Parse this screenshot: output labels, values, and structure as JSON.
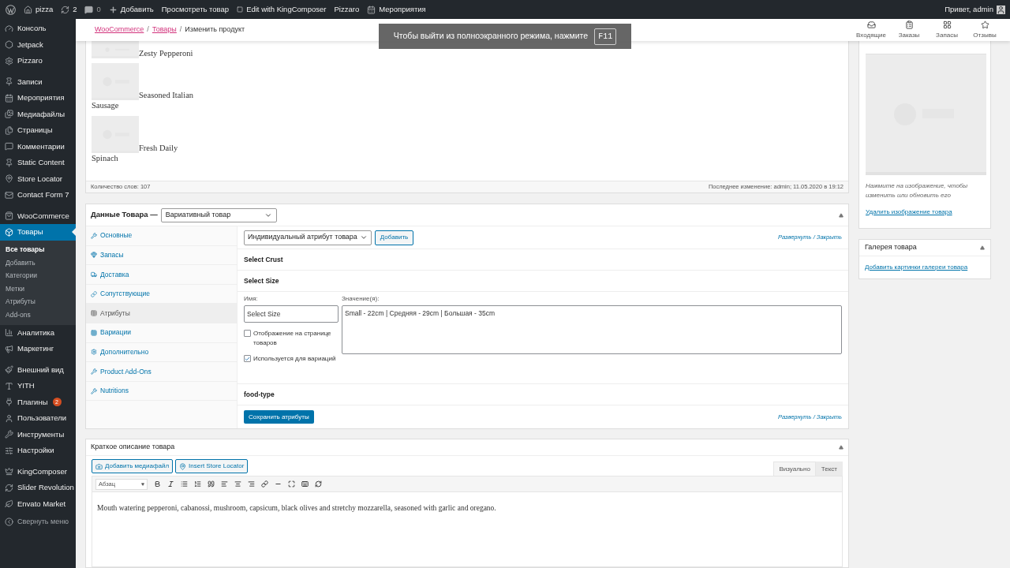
{
  "admin_bar": {
    "items": [
      {
        "kind": "logo"
      },
      {
        "kind": "home",
        "label": "pizza"
      },
      {
        "kind": "updates",
        "label": "2"
      },
      {
        "kind": "comments",
        "label": "0"
      },
      {
        "kind": "new",
        "label": "Добавить"
      },
      {
        "kind": "text",
        "label": "Просмотреть товар"
      },
      {
        "kind": "kc",
        "label": "Edit with KingComposer"
      },
      {
        "kind": "text",
        "label": "Pizzaro"
      },
      {
        "kind": "calendar",
        "label": "Мероприятия"
      }
    ],
    "greeting": "Привет, admin"
  },
  "sidebar": {
    "groups": [
      {
        "items": [
          {
            "label": "Консоль",
            "selected": false
          },
          {
            "label": "Jetpack",
            "selected": false
          },
          {
            "label": "Pizzaro",
            "selected": false
          }
        ]
      },
      {
        "items": [
          {
            "label": "Записи",
            "selected": false
          },
          {
            "label": "Мероприятия",
            "selected": false
          },
          {
            "label": "Медиафайлы",
            "selected": false
          },
          {
            "label": "Страницы",
            "selected": false
          },
          {
            "label": "Комментарии",
            "selected": false
          },
          {
            "label": "Static Content",
            "selected": false
          },
          {
            "label": "Store Locator",
            "selected": false
          },
          {
            "label": "Contact Form 7",
            "selected": false
          }
        ]
      },
      {
        "items": [
          {
            "label": "WooCommerce",
            "selected": false
          },
          {
            "label": "Товары",
            "selected": true,
            "children": [
              {
                "label": "Все товары",
                "selected": true
              },
              {
                "label": "Добавить",
                "selected": false
              },
              {
                "label": "Категории",
                "selected": false
              },
              {
                "label": "Метки",
                "selected": false
              },
              {
                "label": "Атрибуты",
                "selected": false
              },
              {
                "label": "Add-ons",
                "selected": false
              }
            ]
          },
          {
            "label": "Аналитика",
            "selected": false
          },
          {
            "label": "Маркетинг",
            "selected": false
          }
        ]
      },
      {
        "items": [
          {
            "label": "Внешний вид",
            "selected": false
          },
          {
            "label": "YITH",
            "selected": false
          },
          {
            "label": "Плагины",
            "selected": false,
            "badge": "2"
          },
          {
            "label": "Пользователи",
            "selected": false
          },
          {
            "label": "Инструменты",
            "selected": false
          },
          {
            "label": "Настройки",
            "selected": false
          }
        ]
      },
      {
        "items": [
          {
            "label": "KingComposer",
            "selected": false
          },
          {
            "label": "Slider Revolution",
            "selected": false
          },
          {
            "label": "Envato Market",
            "selected": false
          }
        ]
      }
    ],
    "collapse": "Свернуть меню"
  },
  "header": {
    "breadcrumbs": [
      {
        "kind": "link",
        "label": "WooCommerce"
      },
      {
        "kind": "sep",
        "label": "/"
      },
      {
        "kind": "link",
        "label": "Товары"
      },
      {
        "kind": "sep",
        "label": "/"
      },
      {
        "kind": "current",
        "label": "Изменить продукт"
      }
    ],
    "actions": [
      "Входящие",
      "Заказы",
      "Запасы",
      "Отзывы"
    ]
  },
  "notice": {
    "text": "Чтобы выйти из полноэкранного режима, нажмите",
    "key": "F11"
  },
  "editor": {
    "blocks": [
      {
        "kind": "partial",
        "text": "Zesty Pepperoni"
      },
      {
        "kind": "full",
        "text": "Seasoned Italian",
        "after": "Sausage"
      },
      {
        "kind": "full",
        "text": "Fresh Daily",
        "after": "Spinach"
      }
    ],
    "word_count": "Количество слов: 107",
    "last_edit": "Последнее изменение: admin; 11.05.2020 в 19:12"
  },
  "product_data": {
    "title": "Данные Товара —",
    "type": "Вариативный товар",
    "tabs": [
      {
        "label": "Основные",
        "selected": false
      },
      {
        "label": "Запасы",
        "selected": false
      },
      {
        "label": "Доставка",
        "selected": false
      },
      {
        "label": "Сопутствующие",
        "selected": false
      },
      {
        "label": "Атрибуты",
        "selected": true
      },
      {
        "label": "Вариации",
        "selected": false
      },
      {
        "label": "Дополнительно",
        "selected": false
      },
      {
        "label": "Product Add-Ons",
        "selected": false
      },
      {
        "label": "Nutritions",
        "selected": false
      }
    ],
    "attribute_select": "Индивидуальный атрибут товара",
    "add_button": "Добавить",
    "expand_link": "Развернуть / Закрыть",
    "attributes": [
      {
        "name": "Select Crust",
        "expanded": false
      },
      {
        "name": "Select Size",
        "expanded": true,
        "name_label": "Имя:",
        "name_value": "Select Size",
        "values_label": "Значение(я):",
        "values": "Small - 22cm | Средняя - 29cm | Большая - 35cm",
        "options": [
          {
            "label": "Отображение на странице товаров",
            "checked": false
          },
          {
            "label": "Используется для вариаций",
            "checked": true
          }
        ]
      },
      {
        "name": "food-type",
        "expanded": false
      }
    ],
    "save_button": "Сохранить атрибуты",
    "footer_link": "Развернуть / Закрыть"
  },
  "short_description": {
    "title": "Краткое описание товара",
    "buttons": [
      "Добавить медиафайл",
      "Insert Store Locator"
    ],
    "modes": [
      {
        "label": "Визуально",
        "selected": true
      },
      {
        "label": "Текст",
        "selected": false
      }
    ],
    "format": "Абзац",
    "text": "Mouth watering pepperoni, cabanossi, mushroom, capsicum, black olives and stretchy mozzarella, seasoned with garlic and oregano."
  },
  "featured_image": {
    "hint": "Нажмите на изображение, чтобы изменить или обновить его",
    "remove_link": "Удалить изображение товара"
  },
  "gallery": {
    "title": "Галерея товара",
    "add_link": "Добавить картинки галереи товара"
  }
}
